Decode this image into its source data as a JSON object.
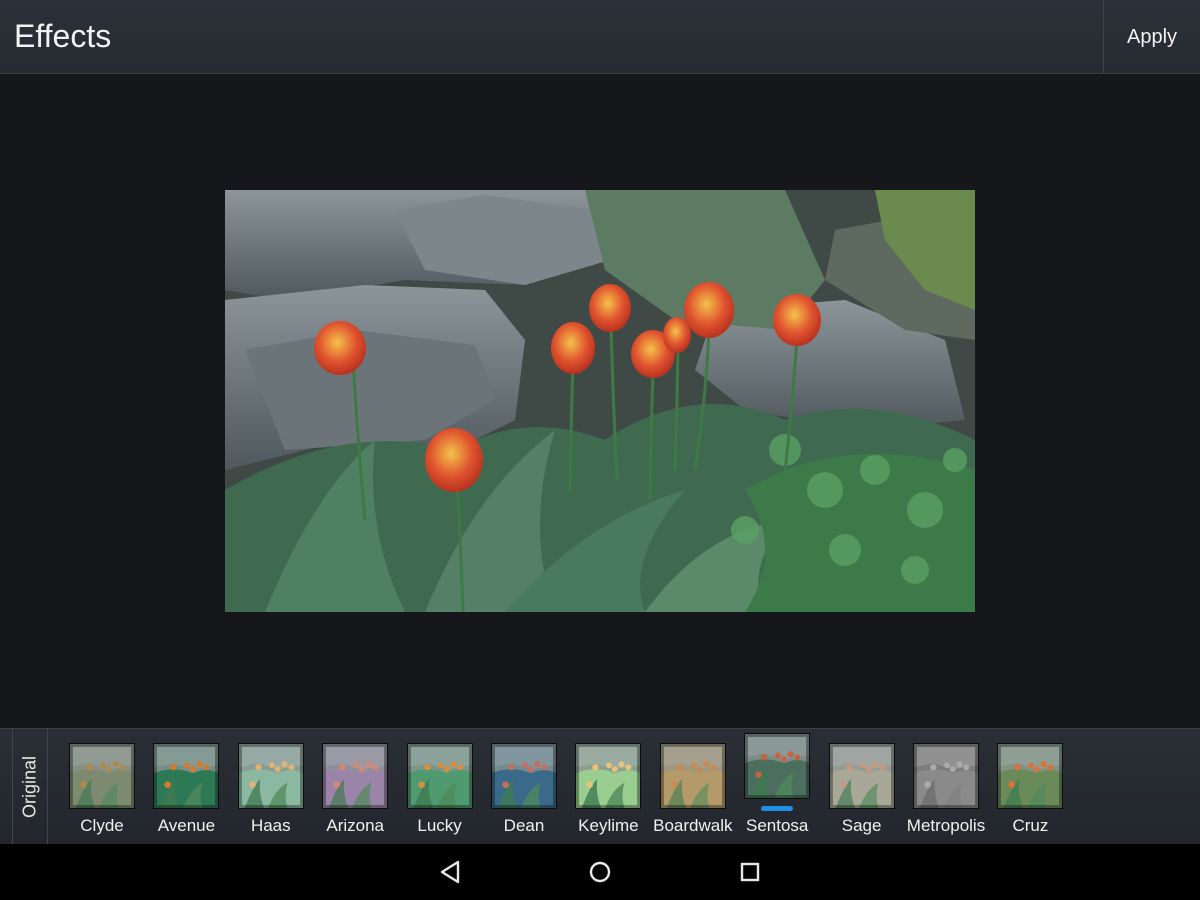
{
  "header": {
    "title": "Effects",
    "apply_label": "Apply"
  },
  "filmstrip": {
    "original_label": "Original",
    "selected": "Sentosa",
    "accent_color": "#1e90e8",
    "effects": [
      {
        "label": "Clyde"
      },
      {
        "label": "Avenue"
      },
      {
        "label": "Haas"
      },
      {
        "label": "Arizona"
      },
      {
        "label": "Lucky"
      },
      {
        "label": "Dean"
      },
      {
        "label": "Keylime"
      },
      {
        "label": "Boardwalk"
      },
      {
        "label": "Sentosa"
      },
      {
        "label": "Sage"
      },
      {
        "label": "Metropolis"
      },
      {
        "label": "Cruz"
      }
    ]
  },
  "navbar": {
    "icons": [
      "back-icon",
      "home-icon",
      "recents-icon"
    ]
  }
}
